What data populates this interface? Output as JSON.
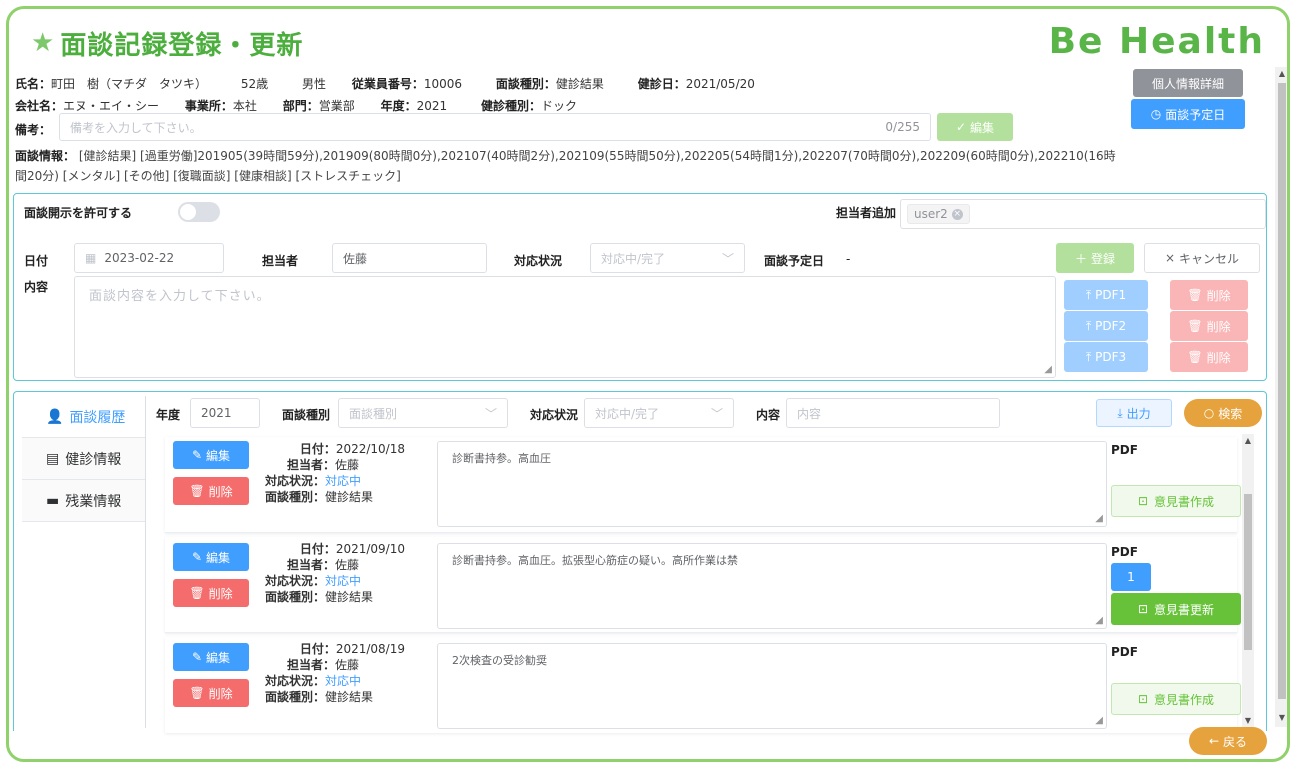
{
  "header": {
    "title": "面談記録登録・更新",
    "brand": "Be Health"
  },
  "employee": {
    "name_label": "氏名：",
    "name": "町田　樹（マチダ　タツキ）",
    "age": "52歳",
    "gender": "男性",
    "emp_no_label": "従業員番号：",
    "emp_no": "10006",
    "interview_type_label": "面談種別：",
    "interview_type": "健診結果",
    "checkup_date_label": "健診日：",
    "checkup_date": "2021/05/20",
    "company_label": "会社名：",
    "company": "エヌ・エイ・シー",
    "office_label": "事業所：",
    "office": "本社",
    "dept_label": "部門：",
    "dept": "営業部",
    "year_label": "年度：",
    "year": "2021",
    "checkup_type_label": "健診種別：",
    "checkup_type": "ドック",
    "note_label": "備考：",
    "note_placeholder": "備考を入力して下さい。",
    "note_count": "0/255",
    "info_label": "面談情報：",
    "info_line1": "[健診結果] [過重労働]201905(39時間59分),201909(80時間0分),202107(40時間2分),202109(55時間50分),202205(54時間1分),202207(70時間0分),202209(60時間0分),202210(16時",
    "info_line2": "間20分) [メンタル] [その他] [復職面談] [健康相談] [ストレスチェック]"
  },
  "buttons": {
    "personal_detail": "個人情報詳細",
    "schedule": "面談予定日",
    "edit_note": "編集",
    "register": "登録",
    "cancel": "キャンセル",
    "pdf1": "PDF1",
    "pdf2": "PDF2",
    "pdf3": "PDF3",
    "delete": "削除",
    "export": "出力",
    "search": "検索",
    "back": "戻る"
  },
  "form": {
    "disclose_label": "面談開示を許可する",
    "assignee_add_label": "担当者追加",
    "assignee_tag": "user2",
    "date_label": "日付",
    "date_value": "2023-02-22",
    "person_label": "担当者",
    "person_value": "佐藤",
    "status_label": "対応状況",
    "status_placeholder": "対応中/完了",
    "scheduled_label": "面談予定日",
    "scheduled_value": "-",
    "content_label": "内容",
    "content_placeholder": "面談内容を入力して下さい。"
  },
  "tabs": [
    {
      "label": "面談履歴",
      "icon": "user-icon"
    },
    {
      "label": "健診情報",
      "icon": "document-icon"
    },
    {
      "label": "残業情報",
      "icon": "briefcase-icon"
    }
  ],
  "filters": {
    "year_label": "年度",
    "year_value": "2021",
    "type_label": "面談種別",
    "type_placeholder": "面談種別",
    "status_label": "対応状況",
    "status_placeholder": "対応中/完了",
    "content_label": "内容",
    "content_placeholder": "内容"
  },
  "records": [
    {
      "edit": "編集",
      "delete": "削除",
      "date_label": "日付：",
      "date": "2022/10/18",
      "person_label": "担当者：",
      "person": "佐藤",
      "status_label": "対応状況：",
      "status": "対応中",
      "type_label": "面談種別：",
      "type": "健診結果",
      "content": "診断書持参。高血圧",
      "pdf_label": "PDF",
      "opinion": "意見書作成"
    },
    {
      "edit": "編集",
      "delete": "削除",
      "date_label": "日付：",
      "date": "2021/09/10",
      "person_label": "担当者：",
      "person": "佐藤",
      "status_label": "対応状況：",
      "status": "対応中",
      "type_label": "面談種別：",
      "type": "健診結果",
      "content": "診断書持参。高血圧。拡張型心筋症の疑い。高所作業は禁",
      "pdf_label": "PDF",
      "pdf_page": "1",
      "opinion": "意見書更新"
    },
    {
      "edit": "編集",
      "delete": "削除",
      "date_label": "日付：",
      "date": "2021/08/19",
      "person_label": "担当者：",
      "person": "佐藤",
      "status_label": "対応状況：",
      "status": "対応中",
      "type_label": "面談種別：",
      "type": "健診結果",
      "content": "2次検査の受診勧奨",
      "pdf_label": "PDF",
      "opinion": "意見書作成"
    }
  ]
}
